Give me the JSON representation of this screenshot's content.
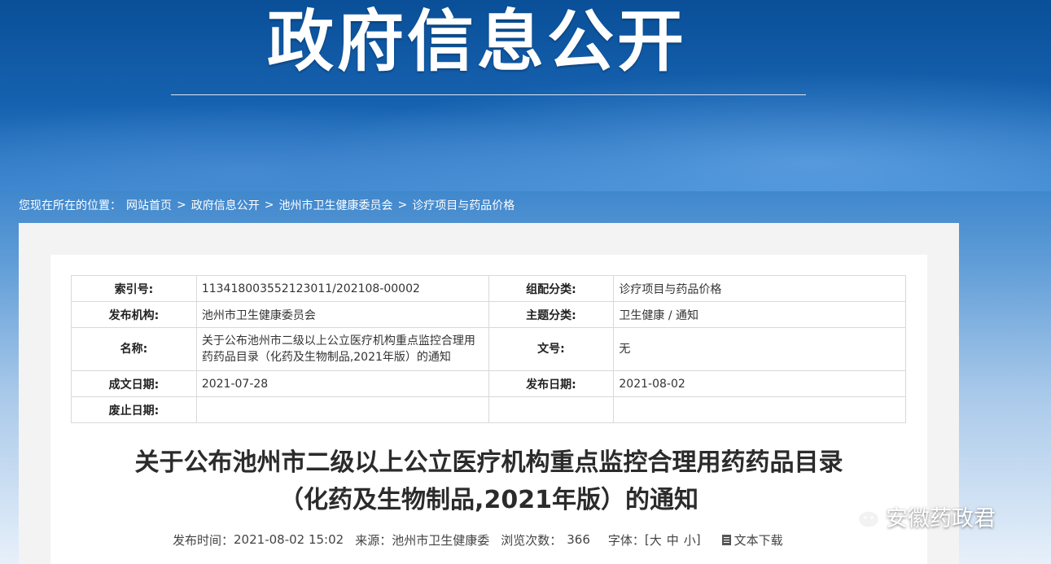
{
  "banner": {
    "title": "政府信息公开"
  },
  "breadcrumb": {
    "prefix": "您现在所在的位置：",
    "items": [
      "网站首页",
      "政府信息公开",
      "池州市卫生健康委员会",
      "诊疗项目与药品价格"
    ],
    "separator": ">"
  },
  "meta": {
    "index_label": "索引号:",
    "index_value": "11341800355212301​1/202108-00002",
    "category_label": "组配分类:",
    "category_value": "诊疗项目与药品价格",
    "publisher_label": "发布机构:",
    "publisher_value": "池州市卫生健康委员会",
    "topic_label": "主题分类:",
    "topic_value": "卫生健康 / 通知",
    "name_label": "名称:",
    "name_value": "关于公布池州市二级以上公立医疗机构重点监控合理用药药品目录（化药及生物制品,2021年版）的通知",
    "docno_label": "文号:",
    "docno_value": "无",
    "created_label": "成文日期:",
    "created_value": "2021-07-28",
    "published_label": "发布日期:",
    "published_value": "2021-08-02",
    "expired_label": "废止日期:",
    "expired_value": ""
  },
  "article": {
    "title_line1": "关于公布池州市二级以上公立医疗机构重点监控合理用药药品目录",
    "title_line2": "（化药及生物制品,2021年版）的通知",
    "publish_time_label": "发布时间：",
    "publish_time": "2021-08-02 15:02",
    "source_label": "来源：",
    "source": "池州市卫生健康委",
    "views_label": "浏览次数：",
    "views": "366",
    "font_label": "字体：",
    "font_open": "[",
    "font_large": "大",
    "font_medium": "中",
    "font_small": "小",
    "font_close": "]",
    "download_label": "文本下载"
  },
  "watermark": {
    "text": "安徽药政君"
  },
  "icons": [
    "document-icon",
    "wechat-icon"
  ]
}
